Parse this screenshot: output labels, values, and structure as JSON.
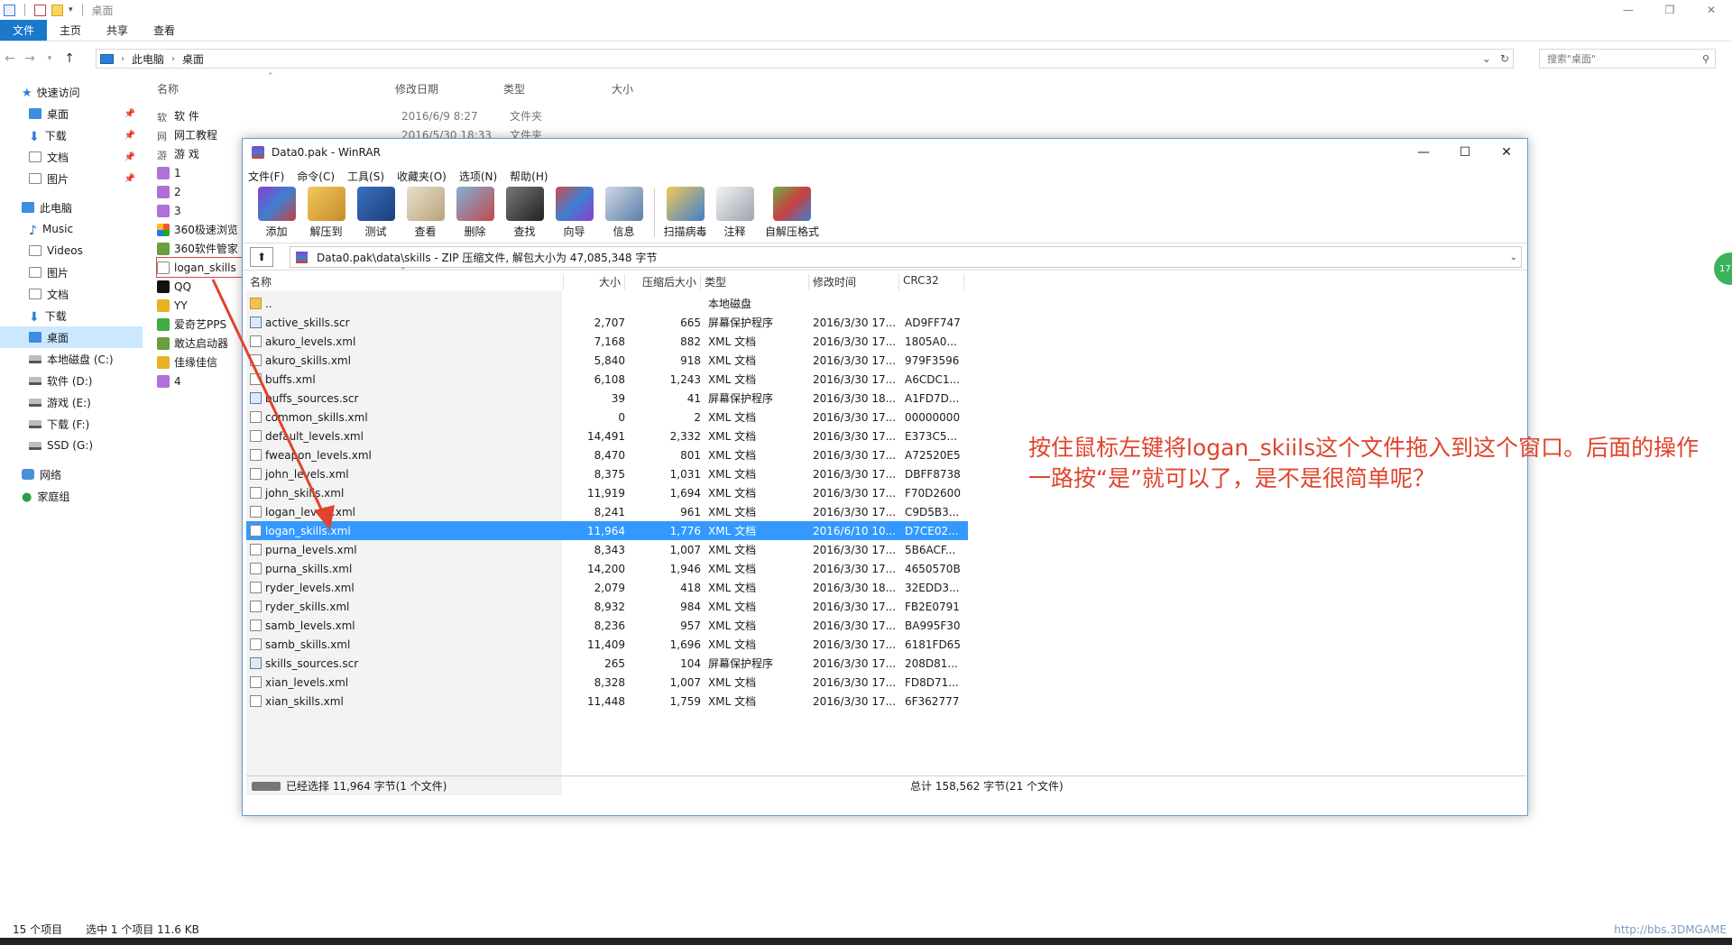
{
  "explorer": {
    "title": "桌面",
    "window_controls": [
      "—",
      "❐",
      "✕"
    ],
    "ribbon_tabs": [
      "文件",
      "主页",
      "共享",
      "查看"
    ],
    "address": [
      "此电脑",
      "桌面"
    ],
    "search_placeholder": "搜索\"桌面\"",
    "nav": [
      {
        "label": "快速访问",
        "group": true
      },
      {
        "label": "桌面",
        "pinned": true
      },
      {
        "label": "下载",
        "pinned": true
      },
      {
        "label": "文档",
        "pinned": true
      },
      {
        "label": "图片",
        "pinned": true
      },
      {
        "label": "此电脑",
        "group": true
      },
      {
        "label": "Music"
      },
      {
        "label": "Videos"
      },
      {
        "label": "图片"
      },
      {
        "label": "文档"
      },
      {
        "label": "下载"
      },
      {
        "label": "桌面",
        "selected": true
      },
      {
        "label": "本地磁盘 (C:)"
      },
      {
        "label": "软件 (D:)"
      },
      {
        "label": "游戏 (E:)"
      },
      {
        "label": "下载 (F:)"
      },
      {
        "label": "SSD (G:)"
      },
      {
        "label": "网络",
        "group": true
      },
      {
        "label": "家庭组",
        "group": true
      }
    ],
    "columns": [
      "名称",
      "修改日期",
      "类型",
      "大小"
    ],
    "files": [
      {
        "name": "软 件",
        "date": "2016/6/9 8:27",
        "type": "文件夹"
      },
      {
        "name": "网工教程",
        "date": "2016/5/30 18:33",
        "type": "文件夹"
      },
      {
        "name": "游 戏"
      },
      {
        "name": "1"
      },
      {
        "name": "2"
      },
      {
        "name": "3"
      },
      {
        "name": "360极速浏览"
      },
      {
        "name": "360软件管家"
      },
      {
        "name": "logan_skills"
      },
      {
        "name": "QQ"
      },
      {
        "name": "YY"
      },
      {
        "name": "爱奇艺PPS"
      },
      {
        "name": "敢达启动器"
      },
      {
        "name": "佳缘佳信"
      },
      {
        "name": "4"
      }
    ],
    "status_count": "15 个项目",
    "status_selected": "选中 1 个项目  11.6 KB"
  },
  "winrar": {
    "title": "Data0.pak - WinRAR",
    "window_controls": [
      "—",
      "☐",
      "✕"
    ],
    "menu": [
      "文件(F)",
      "命令(C)",
      "工具(S)",
      "收藏夹(O)",
      "选项(N)",
      "帮助(H)"
    ],
    "toolbar": [
      "添加",
      "解压到",
      "测试",
      "查看",
      "删除",
      "查找",
      "向导",
      "信息",
      "扫描病毒",
      "注释",
      "自解压格式"
    ],
    "path": "Data0.pak\\data\\skills - ZIP 压缩文件, 解包大小为 47,085,348 字节",
    "columns": [
      "名称",
      "大小",
      "压缩后大小",
      "类型",
      "修改时间",
      "CRC32"
    ],
    "rows": [
      {
        "name": "..",
        "size": "",
        "packed": "",
        "type": "本地磁盘",
        "mod": "",
        "crc": "",
        "kind": "folder"
      },
      {
        "name": "active_skills.scr",
        "size": "2,707",
        "packed": "665",
        "type": "屏幕保护程序",
        "mod": "2016/3/30 17...",
        "crc": "AD9FF747",
        "kind": "scr"
      },
      {
        "name": "akuro_levels.xml",
        "size": "7,168",
        "packed": "882",
        "type": "XML 文档",
        "mod": "2016/3/30 17...",
        "crc": "1805A0...",
        "kind": "xml"
      },
      {
        "name": "akuro_skills.xml",
        "size": "5,840",
        "packed": "918",
        "type": "XML 文档",
        "mod": "2016/3/30 17...",
        "crc": "979F3596",
        "kind": "xml"
      },
      {
        "name": "buffs.xml",
        "size": "6,108",
        "packed": "1,243",
        "type": "XML 文档",
        "mod": "2016/3/30 17...",
        "crc": "A6CDC1...",
        "kind": "xml"
      },
      {
        "name": "buffs_sources.scr",
        "size": "39",
        "packed": "41",
        "type": "屏幕保护程序",
        "mod": "2016/3/30 18...",
        "crc": "A1FD7D...",
        "kind": "scr"
      },
      {
        "name": "common_skills.xml",
        "size": "0",
        "packed": "2",
        "type": "XML 文档",
        "mod": "2016/3/30 17...",
        "crc": "00000000",
        "kind": "xml"
      },
      {
        "name": "default_levels.xml",
        "size": "14,491",
        "packed": "2,332",
        "type": "XML 文档",
        "mod": "2016/3/30 17...",
        "crc": "E373C5...",
        "kind": "xml"
      },
      {
        "name": "fweapon_levels.xml",
        "size": "8,470",
        "packed": "801",
        "type": "XML 文档",
        "mod": "2016/3/30 17...",
        "crc": "A72520E5",
        "kind": "xml"
      },
      {
        "name": "john_levels.xml",
        "size": "8,375",
        "packed": "1,031",
        "type": "XML 文档",
        "mod": "2016/3/30 17...",
        "crc": "DBFF8738",
        "kind": "xml"
      },
      {
        "name": "john_skills.xml",
        "size": "11,919",
        "packed": "1,694",
        "type": "XML 文档",
        "mod": "2016/3/30 17...",
        "crc": "F70D2600",
        "kind": "xml"
      },
      {
        "name": "logan_levels.xml",
        "size": "8,241",
        "packed": "961",
        "type": "XML 文档",
        "mod": "2016/3/30 17...",
        "crc": "C9D5B3...",
        "kind": "xml"
      },
      {
        "name": "logan_skills.xml",
        "size": "11,964",
        "packed": "1,776",
        "type": "XML 文档",
        "mod": "2016/6/10 10...",
        "crc": "D7CE02...",
        "kind": "xml",
        "selected": true
      },
      {
        "name": "purna_levels.xml",
        "size": "8,343",
        "packed": "1,007",
        "type": "XML 文档",
        "mod": "2016/3/30 17...",
        "crc": "5B6ACF...",
        "kind": "xml"
      },
      {
        "name": "purna_skills.xml",
        "size": "14,200",
        "packed": "1,946",
        "type": "XML 文档",
        "mod": "2016/3/30 17...",
        "crc": "4650570B",
        "kind": "xml"
      },
      {
        "name": "ryder_levels.xml",
        "size": "2,079",
        "packed": "418",
        "type": "XML 文档",
        "mod": "2016/3/30 18...",
        "crc": "32EDD3...",
        "kind": "xml"
      },
      {
        "name": "ryder_skills.xml",
        "size": "8,932",
        "packed": "984",
        "type": "XML 文档",
        "mod": "2016/3/30 17...",
        "crc": "FB2E0791",
        "kind": "xml"
      },
      {
        "name": "samb_levels.xml",
        "size": "8,236",
        "packed": "957",
        "type": "XML 文档",
        "mod": "2016/3/30 17...",
        "crc": "BA995F30",
        "kind": "xml"
      },
      {
        "name": "samb_skills.xml",
        "size": "11,409",
        "packed": "1,696",
        "type": "XML 文档",
        "mod": "2016/3/30 17...",
        "crc": "6181FD65",
        "kind": "xml"
      },
      {
        "name": "skills_sources.scr",
        "size": "265",
        "packed": "104",
        "type": "屏幕保护程序",
        "mod": "2016/3/30 17...",
        "crc": "208D81...",
        "kind": "scr"
      },
      {
        "name": "xian_levels.xml",
        "size": "8,328",
        "packed": "1,007",
        "type": "XML 文档",
        "mod": "2016/3/30 17...",
        "crc": "FD8D71...",
        "kind": "xml"
      },
      {
        "name": "xian_skills.xml",
        "size": "11,448",
        "packed": "1,759",
        "type": "XML 文档",
        "mod": "2016/3/30 17...",
        "crc": "6F362777",
        "kind": "xml"
      }
    ],
    "status_left": "已经选择 11,964 字节(1 个文件)",
    "status_right": "总计 158,562 字节(21 个文件)"
  },
  "annotation": "按住鼠标左键将logan_skiils这个文件拖入到这个窗口。后面的操作一路按“是”就可以了，是不是很简单呢？",
  "side_badge": "17",
  "watermark": "http://bbs.3DMGAME",
  "colors": {
    "accent": "#1979ca",
    "selection": "#3399ff",
    "annotation": "#e0442c"
  }
}
